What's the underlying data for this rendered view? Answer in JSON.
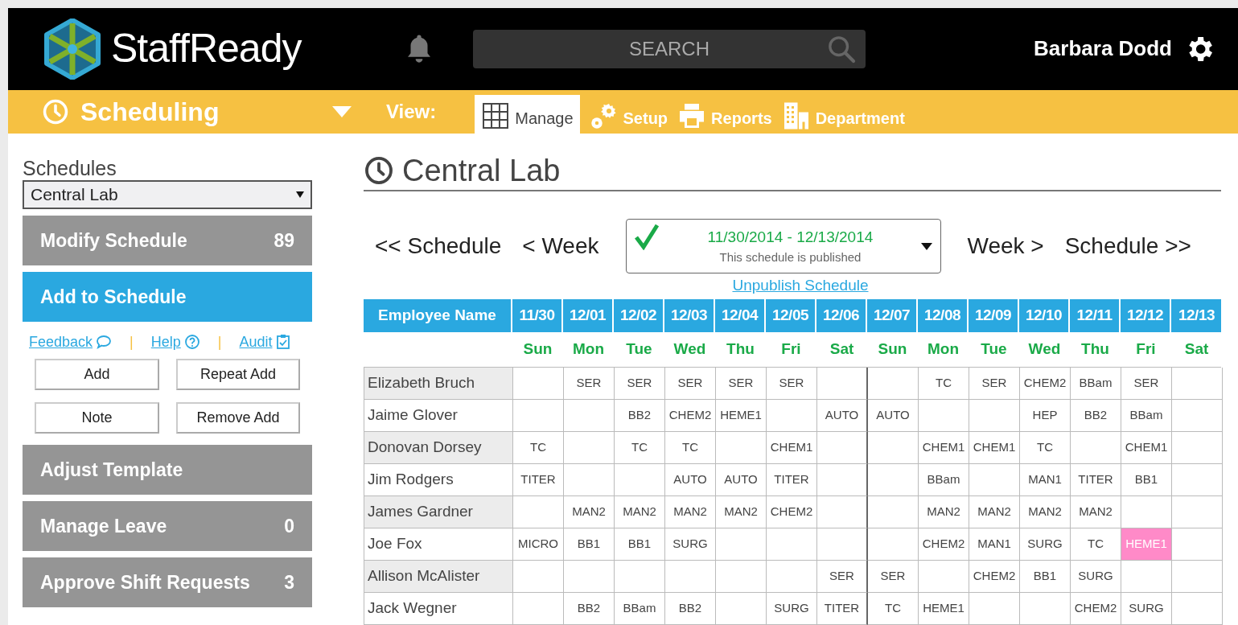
{
  "header": {
    "logo": "StaffReady",
    "search": {
      "placeholder": "SEARCH"
    },
    "user": "Barbara Dodd"
  },
  "module_bar": {
    "title": "Scheduling",
    "view_label": "View:",
    "tabs": [
      {
        "label": "Manage",
        "selected": true
      },
      {
        "label": "Setup",
        "selected": false
      },
      {
        "label": "Reports",
        "selected": false
      },
      {
        "label": "Department",
        "selected": false
      }
    ]
  },
  "sidebar": {
    "heading": "Schedules",
    "schedule_select": "Central Lab",
    "items": [
      {
        "label": "Modify Schedule",
        "count": "89",
        "selected": false
      },
      {
        "label": "Add to Schedule",
        "selected": true,
        "links": [
          "Feedback",
          "Help",
          "Audit"
        ],
        "link_separator": "|",
        "buttons": [
          "Add",
          "Repeat Add",
          "Note",
          "Remove Add"
        ]
      },
      {
        "label": "Adjust Template",
        "selected": false
      },
      {
        "label": "Manage Leave",
        "count": "0",
        "selected": false
      },
      {
        "label": "Approve Shift Requests",
        "count": "3",
        "selected": false
      }
    ]
  },
  "main": {
    "title": "Central Lab",
    "nav": [
      "<< Schedule",
      "< Week",
      "Week >",
      "Schedule >>"
    ],
    "period": {
      "range": "11/30/2014 - 12/13/2014",
      "status": "This schedule is published",
      "published": true
    },
    "unpublish_link": "Unpublish Schedule",
    "table": {
      "name_header": "Employee Name",
      "dates": [
        "11/30",
        "12/01",
        "12/02",
        "12/03",
        "12/04",
        "12/05",
        "12/06",
        "12/07",
        "12/08",
        "12/09",
        "12/10",
        "12/11",
        "12/12",
        "12/13"
      ],
      "weekdays": [
        "Sun",
        "Mon",
        "Tue",
        "Wed",
        "Thu",
        "Fri",
        "Sat",
        "Sun",
        "Mon",
        "Tue",
        "Wed",
        "Thu",
        "Fri",
        "Sat"
      ],
      "rows": [
        {
          "name": "Elizabeth Bruch",
          "cells": [
            {
              "highlighted": false
            },
            {
              "shift": "SER",
              "highlighted": false
            },
            {
              "shift": "SER",
              "highlighted": false
            },
            {
              "shift": "SER",
              "highlighted": false
            },
            {
              "shift": "SER",
              "highlighted": false
            },
            {
              "shift": "SER",
              "highlighted": false
            },
            {
              "highlighted": false
            },
            {
              "highlighted": false
            },
            {
              "shift": "TC",
              "highlighted": false
            },
            {
              "shift": "SER",
              "highlighted": false
            },
            {
              "shift": "CHEM2",
              "highlighted": false
            },
            {
              "shift": "BBam",
              "highlighted": false
            },
            {
              "shift": "SER",
              "highlighted": false
            },
            {
              "highlighted": false
            }
          ]
        },
        {
          "name": "Jaime Glover",
          "cells": [
            {
              "highlighted": false
            },
            {
              "highlighted": false
            },
            {
              "shift": "BB2",
              "highlighted": false
            },
            {
              "shift": "CHEM2",
              "highlighted": false
            },
            {
              "shift": "HEME1",
              "highlighted": false
            },
            {
              "highlighted": false
            },
            {
              "shift": "AUTO",
              "highlighted": false
            },
            {
              "shift": "AUTO",
              "highlighted": false
            },
            {
              "highlighted": false
            },
            {
              "highlighted": false
            },
            {
              "shift": "HEP",
              "highlighted": false
            },
            {
              "shift": "BB2",
              "highlighted": false
            },
            {
              "shift": "BBam",
              "highlighted": false
            },
            {
              "highlighted": false
            }
          ]
        },
        {
          "name": "Donovan Dorsey",
          "cells": [
            {
              "shift": "TC",
              "highlighted": false
            },
            {
              "highlighted": false
            },
            {
              "shift": "TC",
              "highlighted": false
            },
            {
              "shift": "TC",
              "highlighted": false
            },
            {
              "highlighted": false
            },
            {
              "shift": "CHEM1",
              "highlighted": false
            },
            {
              "highlighted": false
            },
            {
              "highlighted": false
            },
            {
              "shift": "CHEM1",
              "highlighted": false
            },
            {
              "shift": "CHEM1",
              "highlighted": false
            },
            {
              "shift": "TC",
              "highlighted": false
            },
            {
              "highlighted": false
            },
            {
              "shift": "CHEM1",
              "highlighted": false
            },
            {
              "highlighted": false
            }
          ]
        },
        {
          "name": "Jim Rodgers",
          "cells": [
            {
              "shift": "TITER",
              "highlighted": false
            },
            {
              "highlighted": false
            },
            {
              "highlighted": false
            },
            {
              "shift": "AUTO",
              "highlighted": false
            },
            {
              "shift": "AUTO",
              "highlighted": false
            },
            {
              "shift": "TITER",
              "highlighted": false
            },
            {
              "highlighted": false
            },
            {
              "highlighted": false
            },
            {
              "shift": "BBam",
              "highlighted": false
            },
            {
              "highlighted": false
            },
            {
              "shift": "MAN1",
              "highlighted": false
            },
            {
              "shift": "TITER",
              "highlighted": false
            },
            {
              "shift": "BB1",
              "highlighted": false
            },
            {
              "highlighted": false
            }
          ]
        },
        {
          "name": "James Gardner",
          "cells": [
            {
              "highlighted": false
            },
            {
              "shift": "MAN2",
              "highlighted": false
            },
            {
              "shift": "MAN2",
              "highlighted": false
            },
            {
              "shift": "MAN2",
              "highlighted": false
            },
            {
              "shift": "MAN2",
              "highlighted": false
            },
            {
              "shift": "CHEM2",
              "highlighted": false
            },
            {
              "highlighted": false
            },
            {
              "highlighted": false
            },
            {
              "shift": "MAN2",
              "highlighted": false
            },
            {
              "shift": "MAN2",
              "highlighted": false
            },
            {
              "shift": "MAN2",
              "highlighted": false
            },
            {
              "shift": "MAN2",
              "highlighted": false
            },
            {
              "highlighted": false
            },
            {
              "highlighted": false
            }
          ]
        },
        {
          "name": "Joe Fox",
          "cells": [
            {
              "shift": "MICRO",
              "highlighted": false
            },
            {
              "shift": "BB1",
              "highlighted": false
            },
            {
              "shift": "BB1",
              "highlighted": false
            },
            {
              "shift": "SURG",
              "highlighted": false
            },
            {
              "highlighted": false
            },
            {
              "highlighted": false
            },
            {
              "highlighted": false
            },
            {
              "highlighted": false
            },
            {
              "shift": "CHEM2",
              "highlighted": false
            },
            {
              "shift": "MAN1",
              "highlighted": false
            },
            {
              "shift": "SURG",
              "highlighted": false
            },
            {
              "shift": "TC",
              "highlighted": false
            },
            {
              "shift": "HEME1",
              "highlighted": true
            },
            {
              "highlighted": false
            }
          ]
        },
        {
          "name": "Allison McAlister",
          "cells": [
            {
              "highlighted": false
            },
            {
              "highlighted": false
            },
            {
              "highlighted": false
            },
            {
              "highlighted": false
            },
            {
              "highlighted": false
            },
            {
              "highlighted": false
            },
            {
              "shift": "SER",
              "highlighted": false
            },
            {
              "shift": "SER",
              "highlighted": false
            },
            {
              "highlighted": false
            },
            {
              "shift": "CHEM2",
              "highlighted": false
            },
            {
              "shift": "BB1",
              "highlighted": false
            },
            {
              "shift": "SURG",
              "highlighted": false
            },
            {
              "highlighted": false
            },
            {
              "highlighted": false
            }
          ]
        },
        {
          "name": "Jack Wegner",
          "cells": [
            {
              "highlighted": false
            },
            {
              "shift": "BB2",
              "highlighted": false
            },
            {
              "shift": "BBam",
              "highlighted": false
            },
            {
              "shift": "BB2",
              "highlighted": false
            },
            {
              "highlighted": false
            },
            {
              "shift": "SURG",
              "highlighted": false
            },
            {
              "shift": "TITER",
              "highlighted": false
            },
            {
              "shift": "TC",
              "highlighted": false
            },
            {
              "shift": "HEME1",
              "highlighted": false
            },
            {
              "highlighted": false
            },
            {
              "highlighted": false
            },
            {
              "shift": "CHEM2",
              "highlighted": false
            },
            {
              "shift": "SURG",
              "highlighted": false
            },
            {
              "highlighted": false
            }
          ]
        }
      ]
    }
  }
}
